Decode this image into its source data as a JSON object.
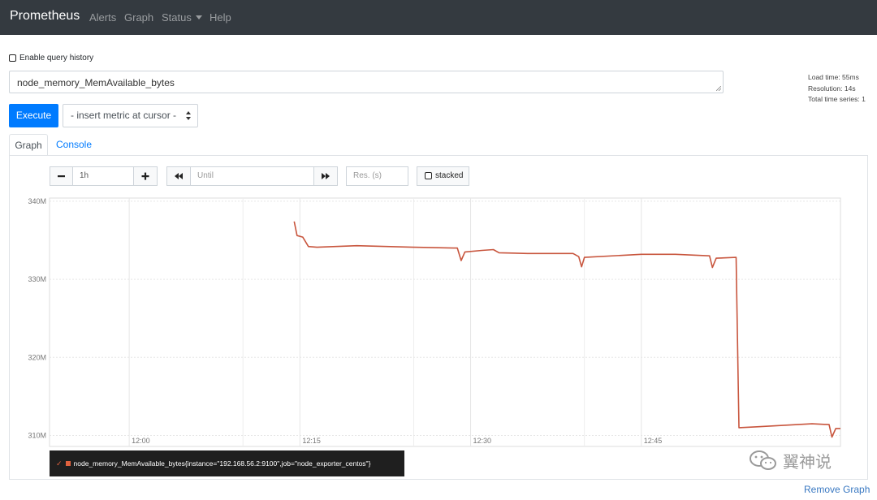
{
  "navbar": {
    "brand": "Prometheus",
    "links": [
      "Alerts",
      "Graph",
      "Status",
      "Help"
    ]
  },
  "query": {
    "history_label": "Enable query history",
    "expression": "node_memory_MemAvailable_bytes"
  },
  "stats": {
    "load_time": "Load time: 55ms",
    "resolution": "Resolution: 14s",
    "total_series": "Total time series: 1"
  },
  "actions": {
    "execute_label": "Execute",
    "metric_select": "- insert metric at cursor -"
  },
  "tabs": {
    "graph": "Graph",
    "console": "Console"
  },
  "controls": {
    "range": "1h",
    "until_placeholder": "Until",
    "res_placeholder": "Res. (s)",
    "stacked_label": "stacked"
  },
  "chart_data": {
    "type": "line",
    "series": [
      {
        "name": "node_memory_MemAvailable_bytes{instance=\"192.168.56.2:9100\",job=\"node_exporter_centos\"}",
        "color": "#c8553d",
        "points": [
          [
            "12:14:30",
            337.4
          ],
          [
            "12:14:45",
            335.6
          ],
          [
            "12:15:15",
            335.4
          ],
          [
            "12:15:45",
            334.2
          ],
          [
            "12:16:30",
            334.1
          ],
          [
            "12:20:00",
            334.3
          ],
          [
            "12:25:00",
            334.1
          ],
          [
            "12:28:30",
            334.0
          ],
          [
            "12:28:50",
            334.0
          ],
          [
            "12:29:10",
            332.4
          ],
          [
            "12:29:30",
            333.5
          ],
          [
            "12:31:00",
            333.7
          ],
          [
            "12:32:00",
            333.8
          ],
          [
            "12:32:30",
            333.4
          ],
          [
            "12:35:00",
            333.3
          ],
          [
            "12:39:00",
            333.3
          ],
          [
            "12:39:30",
            332.9
          ],
          [
            "12:39:45",
            331.6
          ],
          [
            "12:40:00",
            332.8
          ],
          [
            "12:45:00",
            333.2
          ],
          [
            "12:48:00",
            333.2
          ],
          [
            "12:51:00",
            333.0
          ],
          [
            "12:51:15",
            331.5
          ],
          [
            "12:51:35",
            332.7
          ],
          [
            "12:53:20",
            332.8
          ],
          [
            "12:53:35",
            311.0
          ],
          [
            "12:55:00",
            311.1
          ],
          [
            "13:00:00",
            311.5
          ],
          [
            "13:01:30",
            311.4
          ],
          [
            "13:01:45",
            309.8
          ],
          [
            "13:02:05",
            310.9
          ],
          [
            "13:02:30",
            310.9
          ]
        ]
      }
    ],
    "x_ticks": [
      "12:00",
      "12:15",
      "12:30",
      "12:45"
    ],
    "y_ticks": [
      "340M",
      "330M",
      "320M",
      "310M"
    ],
    "ylim": [
      308.6,
      340.4
    ],
    "xlim": [
      "11:53:00",
      "13:02:30"
    ],
    "grid": true,
    "legend": "bottom"
  },
  "legend_text": "node_memory_MemAvailable_bytes{instance=\"192.168.56.2:9100\",job=\"node_exporter_centos\"}",
  "watermark": "翼神说",
  "remove_graph": "Remove Graph"
}
